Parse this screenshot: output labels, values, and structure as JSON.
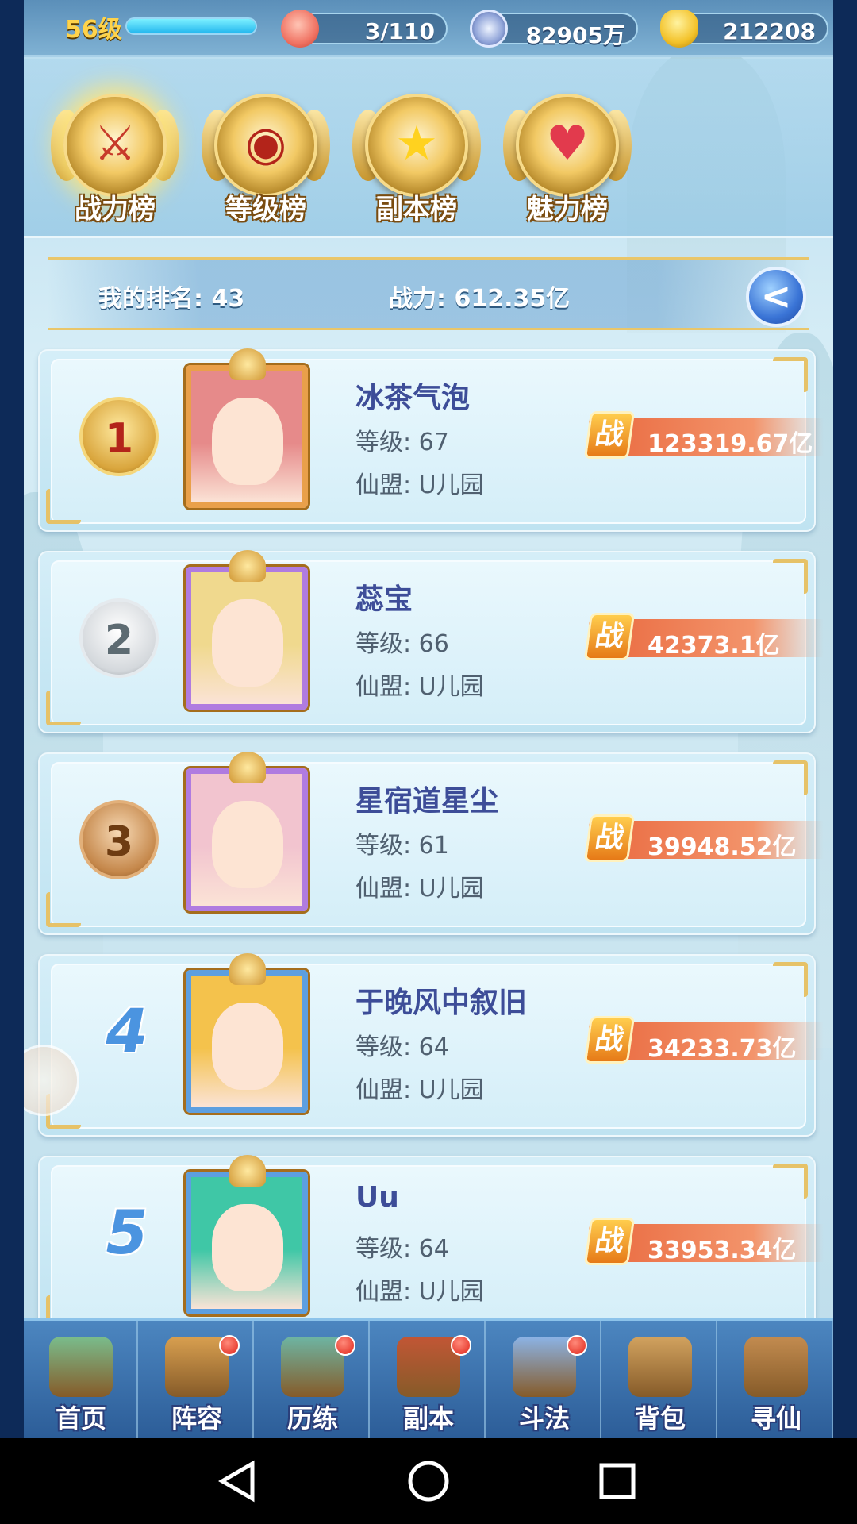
{
  "topbar": {
    "level": "56级",
    "xp_fraction": 1.0,
    "stamina": "3/110",
    "copper": "82905万",
    "gold": "212208",
    "icons": [
      "peach-icon",
      "coin-icon",
      "gold-ingot-icon"
    ]
  },
  "tabs": [
    {
      "label": "战力榜",
      "icon": "sword-medal-icon",
      "active": true
    },
    {
      "label": "等级榜",
      "icon": "drum-medal-icon",
      "active": false
    },
    {
      "label": "副本榜",
      "icon": "star-medal-icon",
      "active": false
    },
    {
      "label": "魅力榜",
      "icon": "heart-medal-icon",
      "active": false
    }
  ],
  "my_rank": {
    "rank_text": "我的排名: 43",
    "power_text": "战力: 612.35亿"
  },
  "back_button": {
    "icon": "back-arrow-icon"
  },
  "ranking": [
    {
      "rank": "1",
      "name": "冰茶气泡",
      "level": "等级: 67",
      "guild": "仙盟: U儿园",
      "power": "123319.67亿",
      "frame": "#e9a04a",
      "hair": "#e68a8a"
    },
    {
      "rank": "2",
      "name": "蕊宝",
      "level": "等级: 66",
      "guild": "仙盟: U儿园",
      "power": "42373.1亿",
      "frame": "#b07be0",
      "hair": "#f0d98e"
    },
    {
      "rank": "3",
      "name": "星宿道星尘",
      "level": "等级: 61",
      "guild": "仙盟: U儿园",
      "power": "39948.52亿",
      "frame": "#b07be0",
      "hair": "#f2c4cf"
    },
    {
      "rank": "4",
      "name": "于晚风中叙旧",
      "level": "等级: 64",
      "guild": "仙盟: U儿园",
      "power": "34233.73亿",
      "frame": "#5d9fe0",
      "hair": "#f4c24c"
    },
    {
      "rank": "5",
      "name": "Uu",
      "level": "等级: 64",
      "guild": "仙盟: U儿园",
      "power": "33953.34亿",
      "frame": "#5d9fe0",
      "hair": "#3fc7a6"
    }
  ],
  "power_icon_label": "战",
  "navbar": [
    {
      "label": "首页",
      "icon": "home-island-icon",
      "dot": false
    },
    {
      "label": "阵容",
      "icon": "cards-icon",
      "dot": true
    },
    {
      "label": "历练",
      "icon": "turtle-icon",
      "dot": true
    },
    {
      "label": "副本",
      "icon": "gate-icon",
      "dot": true
    },
    {
      "label": "斗法",
      "icon": "crossed-swords-icon",
      "dot": true
    },
    {
      "label": "背包",
      "icon": "bag-icon",
      "dot": false
    },
    {
      "label": "寻仙",
      "icon": "scroll-icon",
      "dot": false
    }
  ],
  "system_nav": {
    "back": "back-triangle-icon",
    "home": "home-circle-icon",
    "recents": "recents-square-icon"
  }
}
